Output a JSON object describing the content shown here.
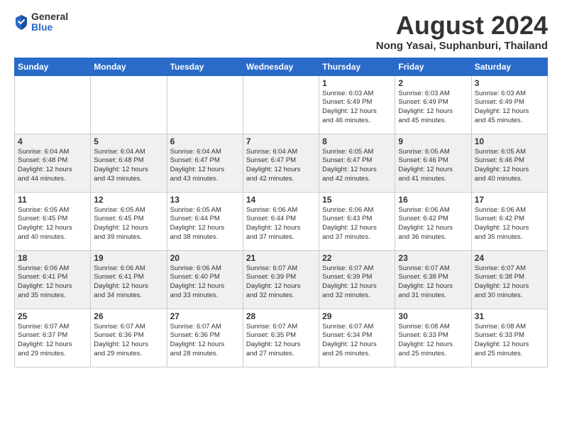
{
  "logo": {
    "general": "General",
    "blue": "Blue"
  },
  "title": "August 2024",
  "location": "Nong Yasai, Suphanburi, Thailand",
  "days_of_week": [
    "Sunday",
    "Monday",
    "Tuesday",
    "Wednesday",
    "Thursday",
    "Friday",
    "Saturday"
  ],
  "weeks": [
    [
      {
        "day": "",
        "info": ""
      },
      {
        "day": "",
        "info": ""
      },
      {
        "day": "",
        "info": ""
      },
      {
        "day": "",
        "info": ""
      },
      {
        "day": "1",
        "info": "Sunrise: 6:03 AM\nSunset: 6:49 PM\nDaylight: 12 hours\nand 46 minutes."
      },
      {
        "day": "2",
        "info": "Sunrise: 6:03 AM\nSunset: 6:49 PM\nDaylight: 12 hours\nand 45 minutes."
      },
      {
        "day": "3",
        "info": "Sunrise: 6:03 AM\nSunset: 6:49 PM\nDaylight: 12 hours\nand 45 minutes."
      }
    ],
    [
      {
        "day": "4",
        "info": "Sunrise: 6:04 AM\nSunset: 6:48 PM\nDaylight: 12 hours\nand 44 minutes."
      },
      {
        "day": "5",
        "info": "Sunrise: 6:04 AM\nSunset: 6:48 PM\nDaylight: 12 hours\nand 43 minutes."
      },
      {
        "day": "6",
        "info": "Sunrise: 6:04 AM\nSunset: 6:47 PM\nDaylight: 12 hours\nand 43 minutes."
      },
      {
        "day": "7",
        "info": "Sunrise: 6:04 AM\nSunset: 6:47 PM\nDaylight: 12 hours\nand 42 minutes."
      },
      {
        "day": "8",
        "info": "Sunrise: 6:05 AM\nSunset: 6:47 PM\nDaylight: 12 hours\nand 42 minutes."
      },
      {
        "day": "9",
        "info": "Sunrise: 6:05 AM\nSunset: 6:46 PM\nDaylight: 12 hours\nand 41 minutes."
      },
      {
        "day": "10",
        "info": "Sunrise: 6:05 AM\nSunset: 6:46 PM\nDaylight: 12 hours\nand 40 minutes."
      }
    ],
    [
      {
        "day": "11",
        "info": "Sunrise: 6:05 AM\nSunset: 6:45 PM\nDaylight: 12 hours\nand 40 minutes."
      },
      {
        "day": "12",
        "info": "Sunrise: 6:05 AM\nSunset: 6:45 PM\nDaylight: 12 hours\nand 39 minutes."
      },
      {
        "day": "13",
        "info": "Sunrise: 6:05 AM\nSunset: 6:44 PM\nDaylight: 12 hours\nand 38 minutes."
      },
      {
        "day": "14",
        "info": "Sunrise: 6:06 AM\nSunset: 6:44 PM\nDaylight: 12 hours\nand 37 minutes."
      },
      {
        "day": "15",
        "info": "Sunrise: 6:06 AM\nSunset: 6:43 PM\nDaylight: 12 hours\nand 37 minutes."
      },
      {
        "day": "16",
        "info": "Sunrise: 6:06 AM\nSunset: 6:42 PM\nDaylight: 12 hours\nand 36 minutes."
      },
      {
        "day": "17",
        "info": "Sunrise: 6:06 AM\nSunset: 6:42 PM\nDaylight: 12 hours\nand 35 minutes."
      }
    ],
    [
      {
        "day": "18",
        "info": "Sunrise: 6:06 AM\nSunset: 6:41 PM\nDaylight: 12 hours\nand 35 minutes."
      },
      {
        "day": "19",
        "info": "Sunrise: 6:06 AM\nSunset: 6:41 PM\nDaylight: 12 hours\nand 34 minutes."
      },
      {
        "day": "20",
        "info": "Sunrise: 6:06 AM\nSunset: 6:40 PM\nDaylight: 12 hours\nand 33 minutes."
      },
      {
        "day": "21",
        "info": "Sunrise: 6:07 AM\nSunset: 6:39 PM\nDaylight: 12 hours\nand 32 minutes."
      },
      {
        "day": "22",
        "info": "Sunrise: 6:07 AM\nSunset: 6:39 PM\nDaylight: 12 hours\nand 32 minutes."
      },
      {
        "day": "23",
        "info": "Sunrise: 6:07 AM\nSunset: 6:38 PM\nDaylight: 12 hours\nand 31 minutes."
      },
      {
        "day": "24",
        "info": "Sunrise: 6:07 AM\nSunset: 6:38 PM\nDaylight: 12 hours\nand 30 minutes."
      }
    ],
    [
      {
        "day": "25",
        "info": "Sunrise: 6:07 AM\nSunset: 6:37 PM\nDaylight: 12 hours\nand 29 minutes."
      },
      {
        "day": "26",
        "info": "Sunrise: 6:07 AM\nSunset: 6:36 PM\nDaylight: 12 hours\nand 29 minutes."
      },
      {
        "day": "27",
        "info": "Sunrise: 6:07 AM\nSunset: 6:36 PM\nDaylight: 12 hours\nand 28 minutes."
      },
      {
        "day": "28",
        "info": "Sunrise: 6:07 AM\nSunset: 6:35 PM\nDaylight: 12 hours\nand 27 minutes."
      },
      {
        "day": "29",
        "info": "Sunrise: 6:07 AM\nSunset: 6:34 PM\nDaylight: 12 hours\nand 26 minutes."
      },
      {
        "day": "30",
        "info": "Sunrise: 6:08 AM\nSunset: 6:33 PM\nDaylight: 12 hours\nand 25 minutes."
      },
      {
        "day": "31",
        "info": "Sunrise: 6:08 AM\nSunset: 6:33 PM\nDaylight: 12 hours\nand 25 minutes."
      }
    ]
  ]
}
